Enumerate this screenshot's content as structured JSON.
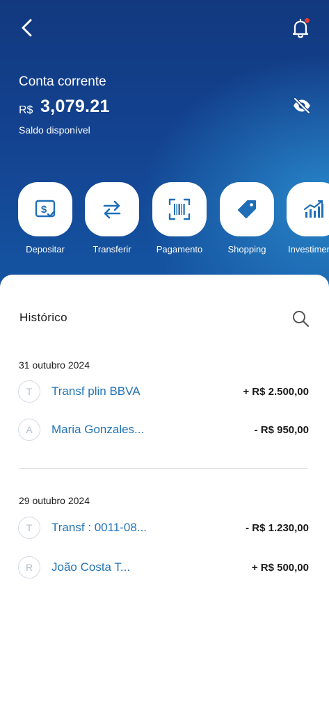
{
  "header": {
    "back_icon": "chevron-left-icon",
    "notification_icon": "bell-icon",
    "notification_dot_color": "#e53935"
  },
  "account": {
    "title": "Conta corrente",
    "currency": "R$",
    "balance": "3,079.21",
    "available_label": "Saldo disponível",
    "visibility_icon": "eye-off-icon"
  },
  "actions": [
    {
      "label": "Depositar",
      "icon": "deposit-icon"
    },
    {
      "label": "Transferir",
      "icon": "transfer-arrows-icon"
    },
    {
      "label": "Pagamento",
      "icon": "barcode-scan-icon"
    },
    {
      "label": "Shopping",
      "icon": "tag-icon"
    },
    {
      "label": "Investimentos",
      "icon": "bar-chart-icon"
    }
  ],
  "history": {
    "title": "Histórico",
    "search_icon": "search-icon",
    "groups": [
      {
        "date": "31 outubro 2024",
        "transactions": [
          {
            "initial": "T",
            "name": "Transf plin BBVA",
            "amount": "+ R$ 2.500,00"
          },
          {
            "initial": "A",
            "name": "Maria Gonzales...",
            "amount": "- R$ 950,00"
          }
        ]
      },
      {
        "date": "29 outubro 2024",
        "transactions": [
          {
            "initial": "T",
            "name": "Transf : 0011-08...",
            "amount": "- R$ 1.230,00"
          },
          {
            "initial": "R",
            "name": "João Costa T...",
            "amount": "+ R$ 500,00"
          }
        ]
      }
    ]
  },
  "colors": {
    "hero_dark": "#12397f",
    "hero_light": "#2c91d2",
    "accent": "#2374b6",
    "icon_blue": "#1f6fb8"
  }
}
